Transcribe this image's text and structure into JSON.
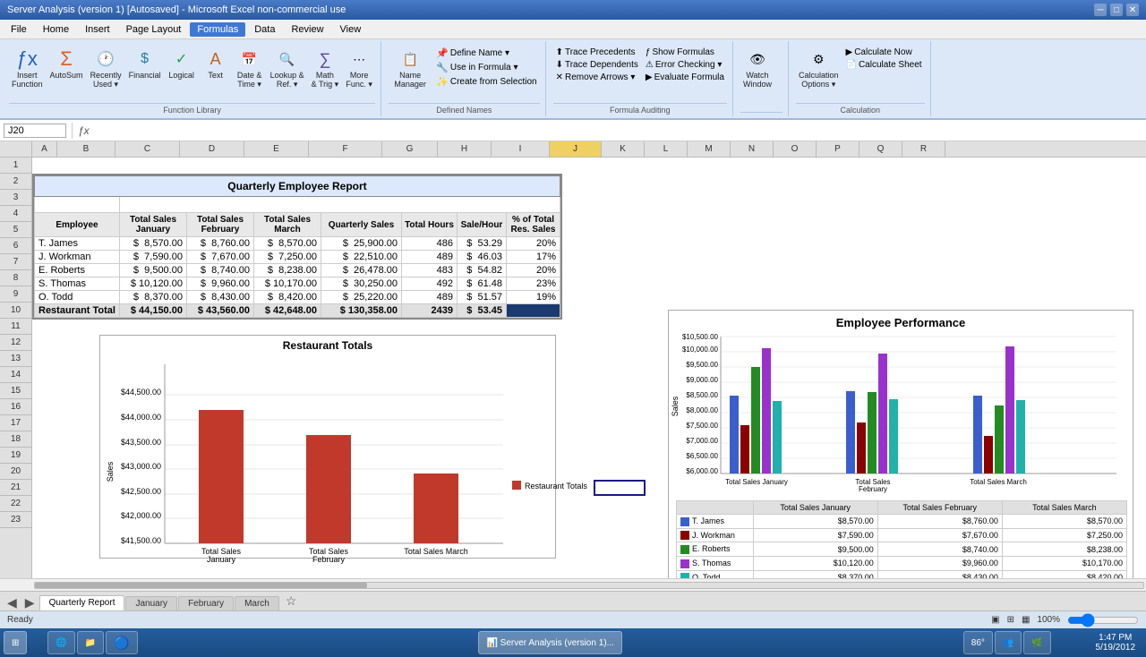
{
  "titleBar": {
    "title": "Server Analysis (version 1) [Autosaved] - Microsoft Excel non-commercial use",
    "controls": [
      "─",
      "□",
      "✕"
    ]
  },
  "menuBar": {
    "items": [
      "File",
      "Home",
      "Insert",
      "Page Layout",
      "Formulas",
      "Data",
      "Review",
      "View"
    ],
    "activeIndex": 4
  },
  "ribbon": {
    "activeTab": "Formulas",
    "groups": [
      {
        "label": "Function Library",
        "icons": [
          {
            "id": "insert-function",
            "label": "Insert\nFunction",
            "icon": "ƒx"
          },
          {
            "id": "autosum",
            "label": "AutoSum",
            "icon": "Σ"
          },
          {
            "id": "recently-used",
            "label": "Recently\nUsed ▾",
            "icon": "🕐"
          },
          {
            "id": "financial",
            "label": "Financial",
            "icon": "$"
          },
          {
            "id": "logical",
            "label": "Logical",
            "icon": "⚑"
          },
          {
            "id": "text",
            "label": "Text",
            "icon": "A"
          },
          {
            "id": "date-time",
            "label": "Date &\nTime ▾",
            "icon": "📅"
          },
          {
            "id": "lookup-ref",
            "label": "Lookup &\nReference ▾",
            "icon": "🔍"
          },
          {
            "id": "math-trig",
            "label": "Math\n& Trig ▾",
            "icon": "∑"
          },
          {
            "id": "more-functions",
            "label": "More\nFunctions ▾",
            "icon": "⋯"
          }
        ]
      },
      {
        "label": "Defined Names",
        "smallIcons": [
          {
            "id": "name-manager",
            "label": "Name Manager",
            "icon": "📋"
          },
          {
            "id": "define-name",
            "label": "Define Name ▾",
            "icon": ""
          },
          {
            "id": "use-in-formula",
            "label": "Use in Formula ▾",
            "icon": ""
          },
          {
            "id": "create-from-selection",
            "label": "Create from Selection",
            "icon": ""
          }
        ]
      },
      {
        "label": "Formula Auditing",
        "smallIcons": [
          {
            "id": "trace-precedents",
            "label": "Trace Precedents",
            "icon": ""
          },
          {
            "id": "trace-dependents",
            "label": "Trace Dependents",
            "icon": ""
          },
          {
            "id": "remove-arrows",
            "label": "Remove Arrows ▾",
            "icon": ""
          },
          {
            "id": "show-formulas",
            "label": "Show Formulas",
            "icon": ""
          },
          {
            "id": "error-checking",
            "label": "Error Checking ▾",
            "icon": ""
          },
          {
            "id": "evaluate-formula",
            "label": "Evaluate Formula",
            "icon": ""
          }
        ]
      },
      {
        "label": "",
        "watchWindow": {
          "label": "Watch\nWindow",
          "icon": "👁"
        }
      },
      {
        "label": "Calculation",
        "smallIcons": [
          {
            "id": "calc-options",
            "label": "Calculation\nOptions ▾",
            "icon": ""
          },
          {
            "id": "calc-now",
            "label": "Calculate Now",
            "icon": ""
          },
          {
            "id": "calc-sheet",
            "label": "Calculate Sheet",
            "icon": ""
          }
        ]
      }
    ]
  },
  "formulaBar": {
    "cellRef": "J20",
    "formula": ""
  },
  "columns": {
    "widths": [
      36,
      60,
      80,
      75,
      75,
      75,
      90,
      68,
      60,
      68,
      60,
      50,
      50,
      50,
      50,
      50,
      50,
      50,
      50
    ],
    "labels": [
      "",
      "A",
      "B",
      "C",
      "D",
      "E",
      "F",
      "G",
      "H",
      "I",
      "J",
      "K",
      "L",
      "M",
      "N",
      "O",
      "P",
      "Q",
      "R"
    ],
    "highlight": "J"
  },
  "report": {
    "title": "Quarterly Employee Report",
    "headers": {
      "employee": "Employee",
      "totalSalesJan": "Total Sales\nJanuary",
      "totalSalesFeb": "Total Sales\nFebruary",
      "totalSalesMar": "Total Sales\nMarch",
      "quarterlySales": "Quarterly Sales",
      "totalHours": "Total Hours",
      "salePerHour": "Sale/Hour",
      "pctTotal": "% of Total\nRes. Sales"
    },
    "rows": [
      {
        "employee": "T. James",
        "jan": "$  8,570.00",
        "feb": "$  8,760.00",
        "mar": "$  8,570.00",
        "quarterly": "$  25,900.00",
        "hours": "486",
        "sph": "$  53.29",
        "pct": "20%"
      },
      {
        "employee": "J. Workman",
        "jan": "$  7,590.00",
        "feb": "$  7,670.00",
        "mar": "$  7,250.00",
        "quarterly": "$  22,510.00",
        "hours": "489",
        "sph": "$  46.03",
        "pct": "17%"
      },
      {
        "employee": "E. Roberts",
        "jan": "$  9,500.00",
        "feb": "$  8,740.00",
        "mar": "$  8,238.00",
        "quarterly": "$  26,478.00",
        "hours": "483",
        "sph": "$  54.82",
        "pct": "20%"
      },
      {
        "employee": "S. Thomas",
        "jan": "$ 10,120.00",
        "feb": "$  9,960.00",
        "mar": "$ 10,170.00",
        "quarterly": "$  30,250.00",
        "hours": "492",
        "sph": "$  61.48",
        "pct": "23%"
      },
      {
        "employee": "O. Todd",
        "jan": "$  8,370.00",
        "feb": "$  8,430.00",
        "mar": "$  8,420.00",
        "quarterly": "$  25,220.00",
        "hours": "489",
        "sph": "$  51.57",
        "pct": "19%"
      },
      {
        "employee": "Restaurant Total",
        "jan": "$ 44,150.00",
        "feb": "$ 43,560.00",
        "mar": "$ 42,648.00",
        "quarterly": "$ 130,358.00",
        "hours": "2439",
        "sph": "$  53.45",
        "pct": ""
      }
    ]
  },
  "restaurantChart": {
    "title": "Restaurant Totals",
    "bars": [
      {
        "label": "Total Sales\nJanuary",
        "value": 44150,
        "color": "#c0392b"
      },
      {
        "label": "Total Sales\nFebruary",
        "value": 43560,
        "color": "#c0392b"
      },
      {
        "label": "Total Sales\nMarch",
        "value": 42648,
        "color": "#c0392b"
      }
    ],
    "yLabels": [
      "$41,500.00",
      "$42,000.00",
      "$42,500.00",
      "$43,000.00",
      "$43,500.00",
      "$44,000.00",
      "$44,500.00"
    ],
    "legend": "Restaurant Totals",
    "yMin": 41000,
    "yMax": 44500
  },
  "employeeChart": {
    "title": "Employee Performance",
    "groups": [
      {
        "label": "Total Sales January",
        "bars": [
          {
            "employee": "T. James",
            "value": 8570,
            "color": "#3a5fcd"
          },
          {
            "employee": "J. Workman",
            "value": 7590,
            "color": "#8b0000"
          },
          {
            "employee": "E. Roberts",
            "value": 9500,
            "color": "#228b22"
          },
          {
            "employee": "S. Thomas",
            "value": 10120,
            "color": "#9932cc"
          },
          {
            "employee": "O. Todd",
            "value": 8370,
            "color": "#20b2aa"
          }
        ]
      },
      {
        "label": "Total Sales February",
        "bars": [
          {
            "employee": "T. James",
            "value": 8760,
            "color": "#3a5fcd"
          },
          {
            "employee": "J. Workman",
            "value": 7670,
            "color": "#8b0000"
          },
          {
            "employee": "E. Roberts",
            "value": 8740,
            "color": "#228b22"
          },
          {
            "employee": "S. Thomas",
            "value": 9960,
            "color": "#9932cc"
          },
          {
            "employee": "O. Todd",
            "value": 8430,
            "color": "#20b2aa"
          }
        ]
      },
      {
        "label": "Total Sales March",
        "bars": [
          {
            "employee": "T. James",
            "value": 8570,
            "color": "#3a5fcd"
          },
          {
            "employee": "J. Workman",
            "value": 7250,
            "color": "#8b0000"
          },
          {
            "employee": "E. Roberts",
            "value": 8238,
            "color": "#228b22"
          },
          {
            "employee": "S. Thomas",
            "value": 10170,
            "color": "#9932cc"
          },
          {
            "employee": "O. Todd",
            "value": 8420,
            "color": "#20b2aa"
          }
        ]
      }
    ],
    "yLabels": [
      "$6,000.00",
      "$6,500.00",
      "$7,000.00",
      "$7,500.00",
      "$8,000.00",
      "$8,500.00",
      "$9,000.00",
      "$9,500.00",
      "$10,000.00",
      "$10,500.00"
    ],
    "yMin": 6000,
    "yMax": 10500,
    "table": {
      "headers": [
        "",
        "Total Sales January",
        "Total Sales February",
        "Total Sales March"
      ],
      "rows": [
        {
          "color": "#3a5fcd",
          "employee": "T. James",
          "jan": "$8,570.00",
          "feb": "$8,760.00",
          "mar": "$8,570.00"
        },
        {
          "color": "#8b0000",
          "employee": "J. Workman",
          "jan": "$7,590.00",
          "feb": "$7,670.00",
          "mar": "$7,250.00"
        },
        {
          "color": "#228b22",
          "employee": "E. Roberts",
          "jan": "$9,500.00",
          "feb": "$8,740.00",
          "mar": "$8,238.00"
        },
        {
          "color": "#9932cc",
          "employee": "S. Thomas",
          "jan": "$10,120.00",
          "feb": "$9,960.00",
          "mar": "$10,170.00"
        },
        {
          "color": "#20b2aa",
          "employee": "O. Todd",
          "jan": "$8,370.00",
          "feb": "$8,430.00",
          "mar": "$8,420.00"
        }
      ]
    }
  },
  "sheetTabs": {
    "tabs": [
      "Quarterly Report",
      "January",
      "February",
      "March"
    ],
    "activeTab": "Quarterly Report"
  },
  "statusBar": {
    "left": "Ready",
    "zoom": "100%"
  },
  "taskbar": {
    "startLabel": "⊞",
    "apps": [
      {
        "id": "ie",
        "label": "🌐"
      },
      {
        "id": "explorer",
        "label": "📁"
      },
      {
        "id": "chrome",
        "label": "🔵"
      },
      {
        "id": "weather",
        "label": "86°"
      },
      {
        "id": "users",
        "label": "👥"
      },
      {
        "id": "excel",
        "label": "📊"
      },
      {
        "id": "other",
        "label": "🌿"
      }
    ],
    "time": "1:47 PM",
    "date": "5/19/2012"
  }
}
